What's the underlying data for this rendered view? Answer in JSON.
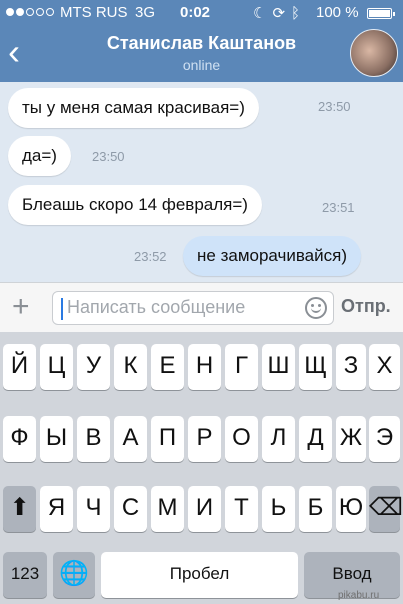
{
  "status_bar": {
    "carrier": "MTS RUS",
    "network": "3G",
    "time": "0:02",
    "battery": "100 %",
    "battery_level": 1.0,
    "signal_dots": [
      true,
      true,
      false,
      false,
      false
    ]
  },
  "header": {
    "back_icon": "chevron-left-icon",
    "contact_name": "Станислав Каштанов",
    "contact_status": "online"
  },
  "messages": [
    {
      "text": "ты у меня самая красивая=)",
      "time": "23:50",
      "direction": "in"
    },
    {
      "text": "да=)",
      "time": "23:50",
      "direction": "in"
    },
    {
      "text": "Блеашь скоро 14 февраля=)",
      "time": "23:51",
      "direction": "in"
    },
    {
      "text": "не заморачивайся)",
      "time": "23:52",
      "direction": "out"
    }
  ],
  "composer": {
    "plus_icon": "plus-icon",
    "placeholder": "Написать сообщение",
    "smile_icon": "smiley-icon",
    "send_label": "Отпр."
  },
  "keyboard": {
    "row1": [
      "Й",
      "Ц",
      "У",
      "К",
      "Е",
      "Н",
      "Г",
      "Ш",
      "Щ",
      "З",
      "Х"
    ],
    "row2": [
      "Ф",
      "Ы",
      "В",
      "А",
      "П",
      "Р",
      "О",
      "Л",
      "Д",
      "Ж",
      "Э"
    ],
    "row3": [
      "Я",
      "Ч",
      "С",
      "М",
      "И",
      "Т",
      "Ь",
      "Б",
      "Ю"
    ],
    "shift_icon": "shift-arrow-icon",
    "backspace_icon": "backspace-icon",
    "numbers_label": "123",
    "globe_icon": "globe-icon",
    "space_label": "Пробел",
    "return_label": "Ввод"
  },
  "watermark": "pikabu.ru",
  "colors": {
    "header": "#5b87b8",
    "chat_bg": "#dfe8f2",
    "outgoing_bubble": "#cfe3f9",
    "keyboard_bg": "#d1d5db"
  }
}
